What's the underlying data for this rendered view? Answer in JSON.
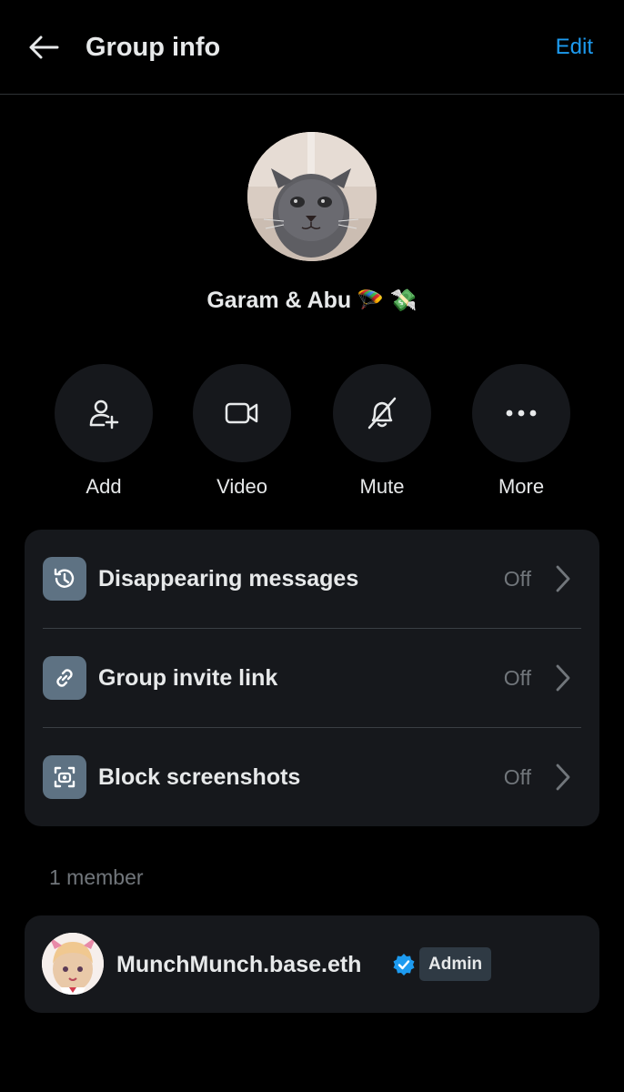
{
  "header": {
    "title": "Group info",
    "edit_label": "Edit"
  },
  "group": {
    "name": "Garam & Abu",
    "name_emojis": "🪂 💸"
  },
  "actions": [
    {
      "label": "Add",
      "icon": "add-user-icon"
    },
    {
      "label": "Video",
      "icon": "video-camera-icon"
    },
    {
      "label": "Mute",
      "icon": "bell-off-icon"
    },
    {
      "label": "More",
      "icon": "more-dots-icon"
    }
  ],
  "settings": [
    {
      "label": "Disappearing messages",
      "value": "Off",
      "icon": "timer-history-icon"
    },
    {
      "label": "Group invite link",
      "value": "Off",
      "icon": "link-icon"
    },
    {
      "label": "Block screenshots",
      "value": "Off",
      "icon": "screenshot-icon"
    }
  ],
  "members": {
    "count_label": "1 member",
    "list": [
      {
        "name": "MunchMunch.base.eth",
        "verified": true,
        "badge": "Admin"
      }
    ]
  },
  "colors": {
    "background": "#000000",
    "surface": "#16181c",
    "accent": "#1d9bf0",
    "icon_tile": "#5e7283",
    "muted_text": "#71767b"
  }
}
